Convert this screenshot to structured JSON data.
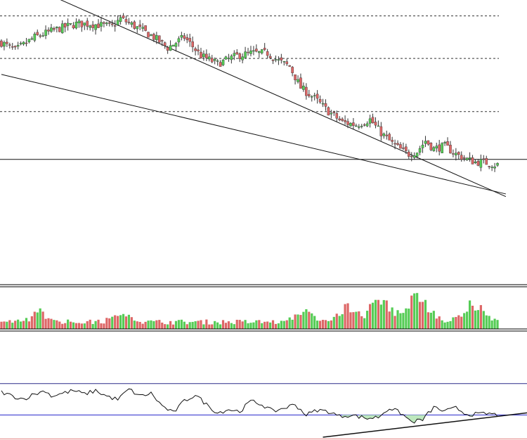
{
  "colors": {
    "background": "#ffffff",
    "up": "#55cc55",
    "down": "#dd6666",
    "wick": "#333333",
    "trendline": "#111111",
    "grid_dotted": "#333333",
    "oscillator_line": "#111111",
    "oscillator_level_upper": "#2a2a8a",
    "oscillator_level_mid": "#2424cc",
    "oscillator_level_lower": "#e58080",
    "fill_below_mid": "#bde8bd"
  },
  "chart_data": [
    {
      "panel": "price",
      "type": "candlestick",
      "title": "",
      "xlabel": "",
      "ylabel": "",
      "x_count": 180,
      "ylim": [
        0,
        100
      ],
      "levels_dotted": [
        94,
        78,
        58
      ],
      "level_solid": 40,
      "trendlines": [
        {
          "from": [
            -24,
            121
          ],
          "to": [
            182,
            26
          ]
        },
        {
          "from": [
            0,
            72
          ],
          "to": [
            182,
            27
          ]
        }
      ],
      "close_path_anchors": [
        [
          0,
          84
        ],
        [
          5,
          81
        ],
        [
          12,
          86
        ],
        [
          20,
          89
        ],
        [
          27,
          91
        ],
        [
          32,
          91
        ],
        [
          40,
          90
        ],
        [
          43,
          93
        ],
        [
          50,
          89
        ],
        [
          55,
          86
        ],
        [
          60,
          82
        ],
        [
          66,
          86
        ],
        [
          72,
          79
        ],
        [
          78,
          76
        ],
        [
          85,
          79
        ],
        [
          90,
          80
        ],
        [
          96,
          80
        ],
        [
          100,
          77
        ],
        [
          104,
          75
        ],
        [
          108,
          67
        ],
        [
          113,
          63
        ],
        [
          118,
          58
        ],
        [
          123,
          54
        ],
        [
          128,
          53
        ],
        [
          133,
          55
        ],
        [
          137,
          50
        ],
        [
          141,
          46
        ],
        [
          145,
          43
        ],
        [
          147,
          42
        ],
        [
          150,
          43
        ],
        [
          153,
          47
        ],
        [
          156,
          44
        ],
        [
          160,
          45
        ],
        [
          164,
          42
        ],
        [
          168,
          40
        ],
        [
          171,
          39
        ],
        [
          174,
          39
        ],
        [
          178,
          38
        ]
      ]
    },
    {
      "panel": "volume",
      "type": "bar",
      "title": "",
      "ylim": [
        0,
        100
      ],
      "base_level": 18,
      "bursts": [
        {
          "center": 14,
          "height": 50
        },
        {
          "center": 43,
          "height": 45
        },
        {
          "center": 109,
          "height": 55
        },
        {
          "center": 125,
          "height": 65
        },
        {
          "center": 137,
          "height": 95
        },
        {
          "center": 150,
          "height": 100
        },
        {
          "center": 170,
          "height": 75
        }
      ]
    },
    {
      "panel": "oscillator",
      "type": "line",
      "title": "",
      "ylim": [
        0,
        100
      ],
      "levels": {
        "upper": 80,
        "mid": 35,
        "lower": 0
      },
      "divergence_line": {
        "from": [
          116,
          3
        ],
        "to": [
          192,
          38
        ]
      },
      "anchors": [
        [
          0,
          68
        ],
        [
          4,
          62
        ],
        [
          8,
          58
        ],
        [
          12,
          65
        ],
        [
          16,
          70
        ],
        [
          18,
          62
        ],
        [
          22,
          66
        ],
        [
          26,
          70
        ],
        [
          30,
          65
        ],
        [
          34,
          70
        ],
        [
          38,
          62
        ],
        [
          42,
          57
        ],
        [
          46,
          72
        ],
        [
          50,
          62
        ],
        [
          54,
          66
        ],
        [
          58,
          48
        ],
        [
          62,
          38
        ],
        [
          66,
          55
        ],
        [
          70,
          64
        ],
        [
          74,
          50
        ],
        [
          78,
          38
        ],
        [
          82,
          43
        ],
        [
          86,
          40
        ],
        [
          90,
          55
        ],
        [
          94,
          50
        ],
        [
          98,
          40
        ],
        [
          102,
          45
        ],
        [
          106,
          50
        ],
        [
          110,
          35
        ],
        [
          114,
          42
        ],
        [
          118,
          40
        ],
        [
          122,
          33
        ],
        [
          126,
          35
        ],
        [
          132,
          30
        ],
        [
          136,
          32
        ],
        [
          140,
          45
        ],
        [
          144,
          38
        ],
        [
          148,
          25
        ],
        [
          152,
          28
        ],
        [
          156,
          46
        ],
        [
          160,
          40
        ],
        [
          164,
          45
        ],
        [
          168,
          36
        ],
        [
          172,
          36
        ],
        [
          176,
          37
        ],
        [
          180,
          34
        ],
        [
          184,
          35
        ]
      ]
    }
  ]
}
